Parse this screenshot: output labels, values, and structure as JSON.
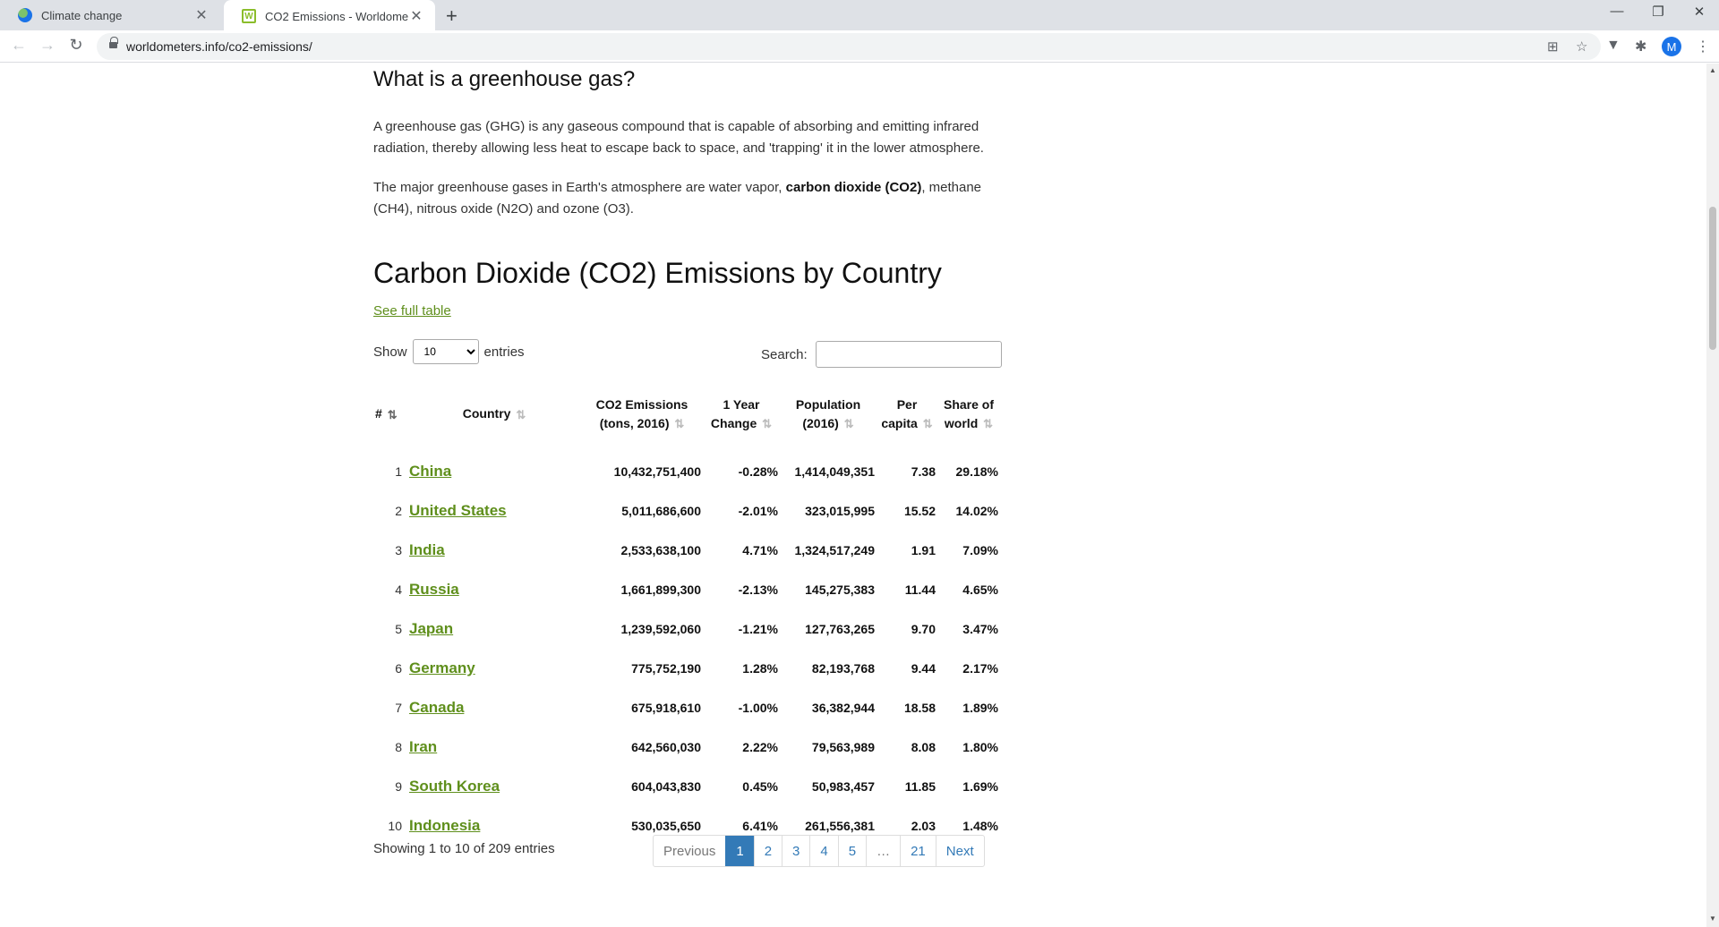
{
  "browser": {
    "tabs": [
      {
        "title": "Climate change",
        "active": false
      },
      {
        "title": "CO2 Emissions - Worldometer",
        "active": true
      }
    ],
    "url": "worldometers.info/co2-emissions/",
    "profile_initial": "M"
  },
  "page": {
    "ghg_heading": "What is a greenhouse gas?",
    "ghg_para1": "A greenhouse gas (GHG) is any gaseous compound that is capable of absorbing and emitting infrared radiation, thereby allowing less heat to escape back to space, and 'trapping' it in the lower atmosphere.",
    "ghg_para2_before": "The major greenhouse gases in Earth's atmosphere are water vapor, ",
    "ghg_para2_bold": "carbon dioxide (CO2)",
    "ghg_para2_after": ", methane (CH4), nitrous oxide (N2O) and ozone (O3).",
    "table_heading": "Carbon Dioxide (CO2) Emissions by Country",
    "full_table_link": "See full table",
    "show_label": "Show",
    "entries_label": "entries",
    "entries_value": "10",
    "search_label": "Search:",
    "columns": [
      "#",
      "Country",
      "CO2 Emissions (tons, 2016)",
      "1 Year Change",
      "Population (2016)",
      "Per capita",
      "Share of world"
    ],
    "rows": [
      [
        "1",
        "China",
        "10,432,751,400",
        "-0.28%",
        "1,414,049,351",
        "7.38",
        "29.18%"
      ],
      [
        "2",
        "United States",
        "5,011,686,600",
        "-2.01%",
        "323,015,995",
        "15.52",
        "14.02%"
      ],
      [
        "3",
        "India",
        "2,533,638,100",
        "4.71%",
        "1,324,517,249",
        "1.91",
        "7.09%"
      ],
      [
        "4",
        "Russia",
        "1,661,899,300",
        "-2.13%",
        "145,275,383",
        "11.44",
        "4.65%"
      ],
      [
        "5",
        "Japan",
        "1,239,592,060",
        "-1.21%",
        "127,763,265",
        "9.70",
        "3.47%"
      ],
      [
        "6",
        "Germany",
        "775,752,190",
        "1.28%",
        "82,193,768",
        "9.44",
        "2.17%"
      ],
      [
        "7",
        "Canada",
        "675,918,610",
        "-1.00%",
        "36,382,944",
        "18.58",
        "1.89%"
      ],
      [
        "8",
        "Iran",
        "642,560,030",
        "2.22%",
        "79,563,989",
        "8.08",
        "1.80%"
      ],
      [
        "9",
        "South Korea",
        "604,043,830",
        "0.45%",
        "50,983,457",
        "11.85",
        "1.69%"
      ],
      [
        "10",
        "Indonesia",
        "530,035,650",
        "6.41%",
        "261,556,381",
        "2.03",
        "1.48%"
      ]
    ],
    "info_text": "Showing 1 to 10 of 209 entries",
    "pagination": [
      "Previous",
      "1",
      "2",
      "3",
      "4",
      "5",
      "…",
      "21",
      "Next"
    ],
    "current_page": "1"
  },
  "colors": {
    "link_green": "#5f8f1c",
    "pager_blue": "#337ab7"
  }
}
